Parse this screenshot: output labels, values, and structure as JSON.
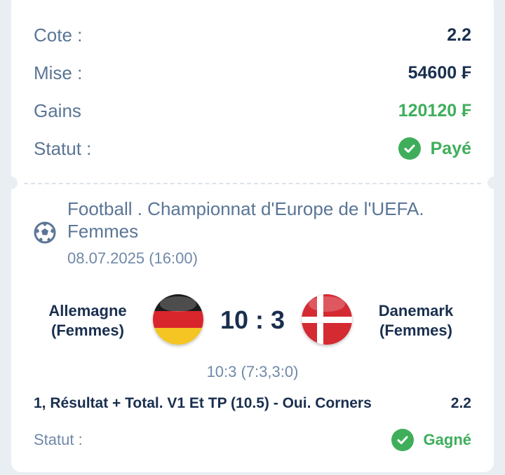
{
  "summary": {
    "odds_label": "Cote :",
    "odds_value": "2.2",
    "stake_label": "Mise :",
    "stake_value": "54600 ₣",
    "winnings_label": "Gains",
    "winnings_value": "120120 ₣",
    "status_label": "Statut :",
    "status_value": "Payé"
  },
  "event": {
    "sport_icon": "football-icon",
    "title": "Football . Championnat d'Europe de l'UEFA. Femmes",
    "date": "08.07.2025 (16:00)",
    "home_team": "Allemagne (Femmes)",
    "away_team": "Danemark (Femmes)",
    "score": "10 : 3",
    "detailed_score": "10:3 (7:3,3:0)"
  },
  "bet": {
    "market": "1, Résultat + Total. V1 Et TP (10.5) - Oui. Corners",
    "odds": "2.2",
    "status_label": "Statut :",
    "status_value": "Gagné"
  },
  "colors": {
    "accent_green": "#3fae5b",
    "text_dark": "#1a2f4f",
    "text_muted": "#5a7596"
  }
}
